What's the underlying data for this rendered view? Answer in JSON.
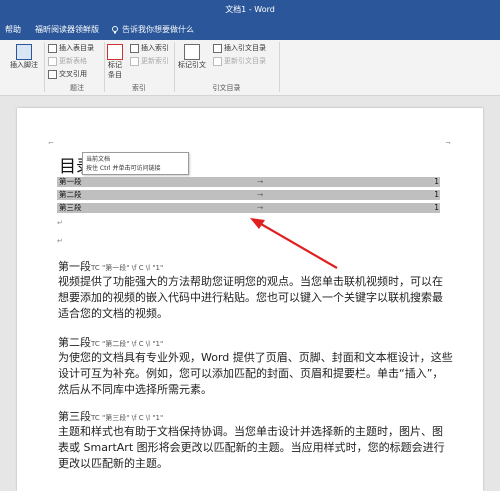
{
  "window": {
    "title": "文档1 - Word"
  },
  "tabs": {
    "help": "帮助",
    "foxit": "福昕阅读器领鲜版",
    "tell_me": "告诉我你想要做什么"
  },
  "ribbon": {
    "insert_footnote": "插入脚注",
    "insert_toc": "插入表目录",
    "update_table": "更新表格",
    "cross_ref": "交叉引用",
    "insert_index": "插入索引",
    "update_index": "更新索引",
    "mark_entry_line1": "标记",
    "mark_entry_line2": "条目",
    "mark_citation": "标记引文",
    "insert_toa": "插入引文目录",
    "update_toa": "更新引文目录",
    "group_captions": "题注",
    "group_index": "索引",
    "group_toa": "引文目录"
  },
  "document": {
    "toc_heading": "目录",
    "tooltip_line1": "当前文档",
    "tooltip_line2": "按住 Ctrl 并单击可访问链接",
    "toc_entries": [
      {
        "label": "第一段",
        "page": "1"
      },
      {
        "label": "第二段",
        "page": "1"
      },
      {
        "label": "第三段",
        "page": "1"
      }
    ],
    "sections": [
      {
        "heading": "第一段",
        "field": "TC \"第一段\" \\f C \\l \"1\" ",
        "text": "视频提供了功能强大的方法帮助您证明您的观点。当您单击联机视频时，可以在想要添加的视频的嵌入代码中进行粘贴。您也可以键入一个关键字以联机搜索最适合您的文档的视频。"
      },
      {
        "heading": "第二段",
        "field": "TC \"第二段\" \\f C \\l \"1\" ",
        "text": "为使您的文档具有专业外观，Word 提供了页眉、页脚、封面和文本框设计，这些设计可互为补充。例如，您可以添加匹配的封面、页眉和提要栏。单击“插入”，然后从不同库中选择所需元素。"
      },
      {
        "heading": "第三段",
        "field": "TC \"第三段\" \\f C \\l \"1\" ",
        "text": "主题和样式也有助于文档保持协调。当您单击设计并选择新的主题时，图片、图表或 SmartArt 图形将会更改以匹配新的主题。当应用样式时，您的标题会进行更改以匹配新的主题。"
      }
    ]
  },
  "colors": {
    "accent": "#2b579a",
    "arrow": "#e02020",
    "field_shade": "#bfbfbf"
  }
}
